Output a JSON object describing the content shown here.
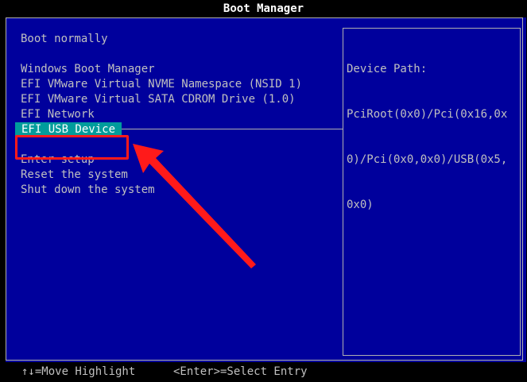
{
  "window": {
    "title": "Boot Manager"
  },
  "menu": {
    "items": [
      "Boot normally",
      "Windows Boot Manager",
      "EFI VMware Virtual NVME Namespace (NSID 1)",
      "EFI VMware Virtual SATA CDROM Drive (1.0)",
      "EFI Network",
      "EFI USB Device",
      "Enter setup",
      "Reset the system",
      "Shut down the system"
    ],
    "selected_index": 5
  },
  "info_panel": {
    "label": "Device Path:",
    "lines": [
      "PciRoot(0x0)/Pci(0x16,0x",
      "0)/Pci(0x0,0x0)/USB(0x5,",
      "0x0)"
    ]
  },
  "footer": {
    "move_hint": "↑↓=Move Highlight",
    "select_hint": "<Enter>=Select Entry"
  },
  "colors": {
    "background": "#00009c",
    "selection": "#009c9c",
    "annotation": "#ff1a1a",
    "text": "#c0c0c0"
  },
  "annotation": {
    "type": "arrow-icon",
    "target": "EFI USB Device"
  }
}
